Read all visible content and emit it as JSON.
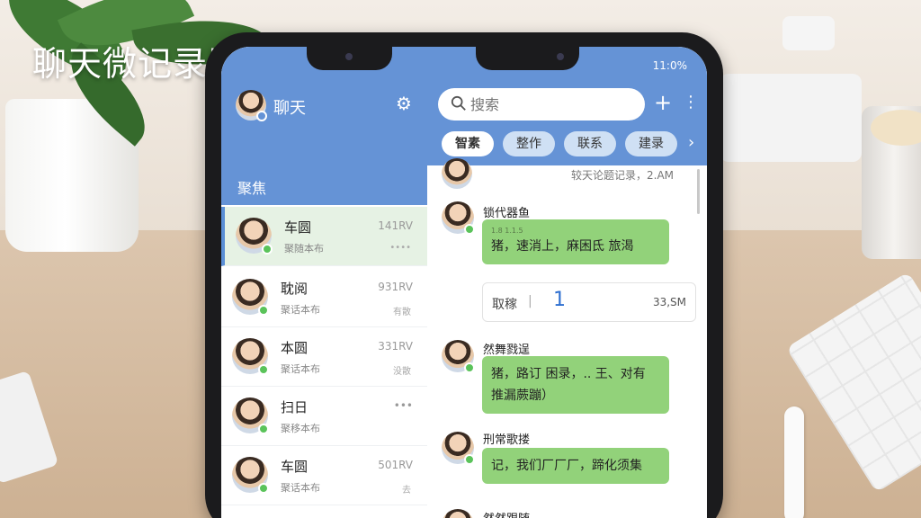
{
  "app_title": "聊天微记录助手 帮",
  "left_panel": {
    "header_title": "聊天",
    "section_label": "聚焦",
    "contacts": [
      {
        "name": "车圆",
        "preview": "聚随本布",
        "time": "141RV",
        "meta": "••••"
      },
      {
        "name": "耽阅",
        "preview": "聚话本布",
        "time": "931RV",
        "meta": "有散"
      },
      {
        "name": "本圆",
        "preview": "聚话本布",
        "time": "331RV",
        "meta": "没散"
      },
      {
        "name": "扫日",
        "preview": "聚移本布",
        "time": "•••",
        "meta": ""
      },
      {
        "name": "车圆",
        "preview": "聚话本布",
        "time": "501RV",
        "meta": "去"
      }
    ]
  },
  "right_panel": {
    "status_text": "11:0%",
    "search_placeholder": "搜索",
    "plus_label": "+",
    "more_label": "⋮",
    "tabs": [
      {
        "label": "智素"
      },
      {
        "label": "整作"
      },
      {
        "label": "联系"
      },
      {
        "label": "建录"
      }
    ],
    "tabs_more": "›",
    "messages": [
      {
        "time": "较天论题记录，2.AM"
      },
      {
        "sender": "锁代器鱼",
        "text": "猪，速消上，麻困氐 旅渴"
      },
      {
        "call_label": "取稼",
        "call_sep": "|",
        "call_value": "1",
        "call_time": "33,SM"
      },
      {
        "sender": "然舞戮逞",
        "text": "猪，路订 困录，.. 王、对有 推漏蕨蹦）"
      },
      {
        "sender": "刑常歌搂",
        "text": "记，我们厂厂厂，蹄化须集"
      },
      {
        "sender": "然然跟随"
      }
    ],
    "tiny_tag": "1.8 1.1.5"
  },
  "colors": {
    "accent_blue": "#6593d6",
    "bubble_green": "#92d27a",
    "online_green": "#5ac35a"
  }
}
